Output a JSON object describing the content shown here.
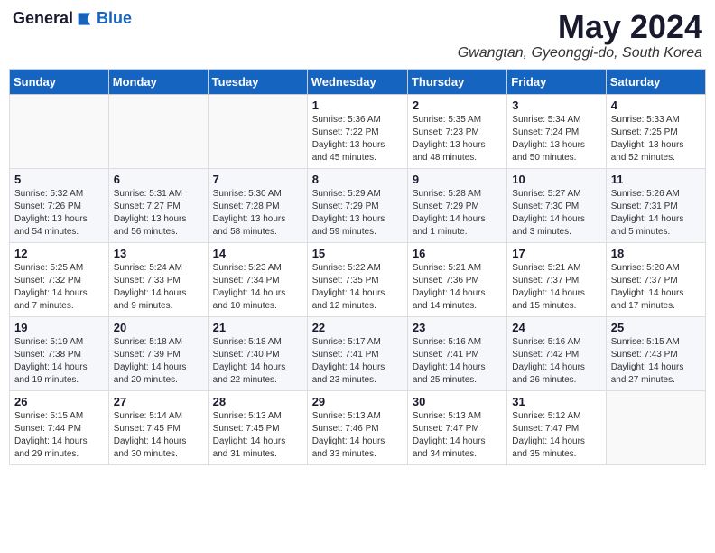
{
  "header": {
    "logo_general": "General",
    "logo_blue": "Blue",
    "month": "May 2024",
    "location": "Gwangtan, Gyeonggi-do, South Korea"
  },
  "weekdays": [
    "Sunday",
    "Monday",
    "Tuesday",
    "Wednesday",
    "Thursday",
    "Friday",
    "Saturday"
  ],
  "weeks": [
    [
      {
        "day": "",
        "content": ""
      },
      {
        "day": "",
        "content": ""
      },
      {
        "day": "",
        "content": ""
      },
      {
        "day": "1",
        "content": "Sunrise: 5:36 AM\nSunset: 7:22 PM\nDaylight: 13 hours\nand 45 minutes."
      },
      {
        "day": "2",
        "content": "Sunrise: 5:35 AM\nSunset: 7:23 PM\nDaylight: 13 hours\nand 48 minutes."
      },
      {
        "day": "3",
        "content": "Sunrise: 5:34 AM\nSunset: 7:24 PM\nDaylight: 13 hours\nand 50 minutes."
      },
      {
        "day": "4",
        "content": "Sunrise: 5:33 AM\nSunset: 7:25 PM\nDaylight: 13 hours\nand 52 minutes."
      }
    ],
    [
      {
        "day": "5",
        "content": "Sunrise: 5:32 AM\nSunset: 7:26 PM\nDaylight: 13 hours\nand 54 minutes."
      },
      {
        "day": "6",
        "content": "Sunrise: 5:31 AM\nSunset: 7:27 PM\nDaylight: 13 hours\nand 56 minutes."
      },
      {
        "day": "7",
        "content": "Sunrise: 5:30 AM\nSunset: 7:28 PM\nDaylight: 13 hours\nand 58 minutes."
      },
      {
        "day": "8",
        "content": "Sunrise: 5:29 AM\nSunset: 7:29 PM\nDaylight: 13 hours\nand 59 minutes."
      },
      {
        "day": "9",
        "content": "Sunrise: 5:28 AM\nSunset: 7:29 PM\nDaylight: 14 hours\nand 1 minute."
      },
      {
        "day": "10",
        "content": "Sunrise: 5:27 AM\nSunset: 7:30 PM\nDaylight: 14 hours\nand 3 minutes."
      },
      {
        "day": "11",
        "content": "Sunrise: 5:26 AM\nSunset: 7:31 PM\nDaylight: 14 hours\nand 5 minutes."
      }
    ],
    [
      {
        "day": "12",
        "content": "Sunrise: 5:25 AM\nSunset: 7:32 PM\nDaylight: 14 hours\nand 7 minutes."
      },
      {
        "day": "13",
        "content": "Sunrise: 5:24 AM\nSunset: 7:33 PM\nDaylight: 14 hours\nand 9 minutes."
      },
      {
        "day": "14",
        "content": "Sunrise: 5:23 AM\nSunset: 7:34 PM\nDaylight: 14 hours\nand 10 minutes."
      },
      {
        "day": "15",
        "content": "Sunrise: 5:22 AM\nSunset: 7:35 PM\nDaylight: 14 hours\nand 12 minutes."
      },
      {
        "day": "16",
        "content": "Sunrise: 5:21 AM\nSunset: 7:36 PM\nDaylight: 14 hours\nand 14 minutes."
      },
      {
        "day": "17",
        "content": "Sunrise: 5:21 AM\nSunset: 7:37 PM\nDaylight: 14 hours\nand 15 minutes."
      },
      {
        "day": "18",
        "content": "Sunrise: 5:20 AM\nSunset: 7:37 PM\nDaylight: 14 hours\nand 17 minutes."
      }
    ],
    [
      {
        "day": "19",
        "content": "Sunrise: 5:19 AM\nSunset: 7:38 PM\nDaylight: 14 hours\nand 19 minutes."
      },
      {
        "day": "20",
        "content": "Sunrise: 5:18 AM\nSunset: 7:39 PM\nDaylight: 14 hours\nand 20 minutes."
      },
      {
        "day": "21",
        "content": "Sunrise: 5:18 AM\nSunset: 7:40 PM\nDaylight: 14 hours\nand 22 minutes."
      },
      {
        "day": "22",
        "content": "Sunrise: 5:17 AM\nSunset: 7:41 PM\nDaylight: 14 hours\nand 23 minutes."
      },
      {
        "day": "23",
        "content": "Sunrise: 5:16 AM\nSunset: 7:41 PM\nDaylight: 14 hours\nand 25 minutes."
      },
      {
        "day": "24",
        "content": "Sunrise: 5:16 AM\nSunset: 7:42 PM\nDaylight: 14 hours\nand 26 minutes."
      },
      {
        "day": "25",
        "content": "Sunrise: 5:15 AM\nSunset: 7:43 PM\nDaylight: 14 hours\nand 27 minutes."
      }
    ],
    [
      {
        "day": "26",
        "content": "Sunrise: 5:15 AM\nSunset: 7:44 PM\nDaylight: 14 hours\nand 29 minutes."
      },
      {
        "day": "27",
        "content": "Sunrise: 5:14 AM\nSunset: 7:45 PM\nDaylight: 14 hours\nand 30 minutes."
      },
      {
        "day": "28",
        "content": "Sunrise: 5:13 AM\nSunset: 7:45 PM\nDaylight: 14 hours\nand 31 minutes."
      },
      {
        "day": "29",
        "content": "Sunrise: 5:13 AM\nSunset: 7:46 PM\nDaylight: 14 hours\nand 33 minutes."
      },
      {
        "day": "30",
        "content": "Sunrise: 5:13 AM\nSunset: 7:47 PM\nDaylight: 14 hours\nand 34 minutes."
      },
      {
        "day": "31",
        "content": "Sunrise: 5:12 AM\nSunset: 7:47 PM\nDaylight: 14 hours\nand 35 minutes."
      },
      {
        "day": "",
        "content": ""
      }
    ]
  ]
}
